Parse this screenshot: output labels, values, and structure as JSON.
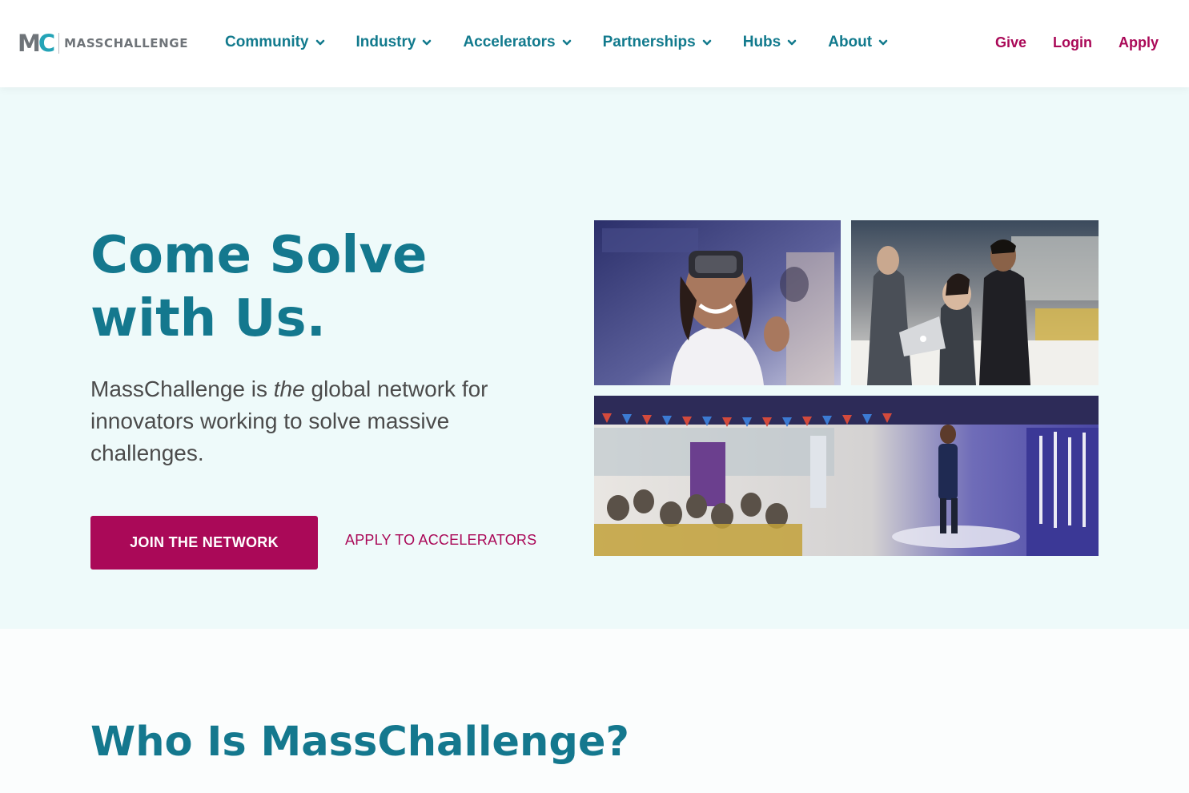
{
  "header": {
    "logo": {
      "mark_m": "M",
      "mark_c": "C",
      "text": "MASSCHALLENGE"
    },
    "nav": [
      {
        "label": "Community"
      },
      {
        "label": "Industry"
      },
      {
        "label": "Accelerators"
      },
      {
        "label": "Partnerships"
      },
      {
        "label": "Hubs"
      },
      {
        "label": "About"
      }
    ],
    "utility": {
      "give": "Give",
      "login": "Login",
      "apply": "Apply"
    }
  },
  "hero": {
    "title_line1": "Come Solve",
    "title_line2": "with Us.",
    "subtitle_before": "MassChallenge is ",
    "subtitle_em": "the",
    "subtitle_after": " global network for innovators working to solve massive challenges.",
    "join_button": "JOIN THE NETWORK",
    "apply_link": "APPLY TO ACCELERATORS",
    "photos": [
      {
        "icon": "photo-vr-headset"
      },
      {
        "icon": "photo-laptop-demo"
      },
      {
        "icon": "photo-stage-presentation"
      }
    ]
  },
  "about": {
    "title": "Who Is MassChallenge?"
  },
  "colors": {
    "teal": "#14788e",
    "magenta": "#aa0958",
    "hero_bg": "#eefafa"
  }
}
